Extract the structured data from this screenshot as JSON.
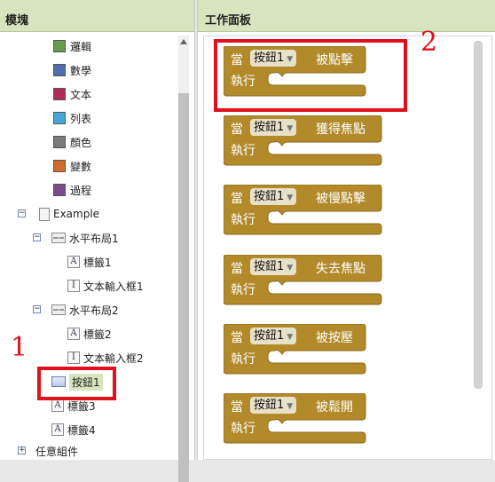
{
  "left_panel": {
    "title": "模塊",
    "tree": [
      {
        "label": "邏輯",
        "color": "#6a9a4f"
      },
      {
        "label": "數學",
        "color": "#4c6fad"
      },
      {
        "label": "文本",
        "color": "#b02b5a"
      },
      {
        "label": "列表",
        "color": "#4aa6d8"
      },
      {
        "label": "顏色",
        "color": "#7a7a7a"
      },
      {
        "label": "變數",
        "color": "#d26a2b"
      },
      {
        "label": "過程",
        "color": "#7a4b8c"
      }
    ],
    "components": {
      "screen": "Example",
      "hbox1": "水平布局1",
      "label1": "標籤1",
      "textbox1": "文本輸入框1",
      "hbox2": "水平布局2",
      "label2": "標籤2",
      "textbox2": "文本輸入框2",
      "button1": "按鈕1",
      "label3": "標籤3",
      "label4": "標籤4",
      "any_component": "任意組件"
    },
    "icons": {
      "label": "A",
      "textbox": "I"
    },
    "expand_minus": "−",
    "expand_plus": "+"
  },
  "right_panel": {
    "title": "工作面板",
    "blocks": [
      {
        "when": "當",
        "component": "按鈕1",
        "event": "被點擊",
        "do": "執行"
      },
      {
        "when": "當",
        "component": "按鈕1",
        "event": "獲得焦點",
        "do": "執行"
      },
      {
        "when": "當",
        "component": "按鈕1",
        "event": "被慢點擊",
        "do": "執行"
      },
      {
        "when": "當",
        "component": "按鈕1",
        "event": "失去焦點",
        "do": "執行"
      },
      {
        "when": "當",
        "component": "按鈕1",
        "event": "被按壓",
        "do": "執行"
      },
      {
        "when": "當",
        "component": "按鈕1",
        "event": "被鬆開",
        "do": "執行"
      }
    ],
    "block_color": "#b28a2a"
  },
  "annotations": {
    "step1": "1",
    "step2": "2",
    "highlight_color": "#e0101c"
  }
}
